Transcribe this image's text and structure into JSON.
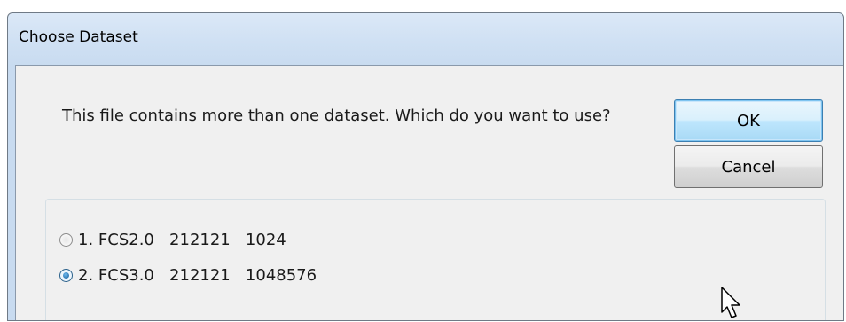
{
  "window": {
    "title": "Choose Dataset"
  },
  "message": "This file contains more than one dataset.  Which do you want to use?",
  "buttons": {
    "ok": "OK",
    "cancel": "Cancel"
  },
  "datasets": [
    {
      "label": "1. FCS2.0   212121   1024",
      "selected": false
    },
    {
      "label": "2. FCS3.0   212121   1048576",
      "selected": true
    }
  ]
}
